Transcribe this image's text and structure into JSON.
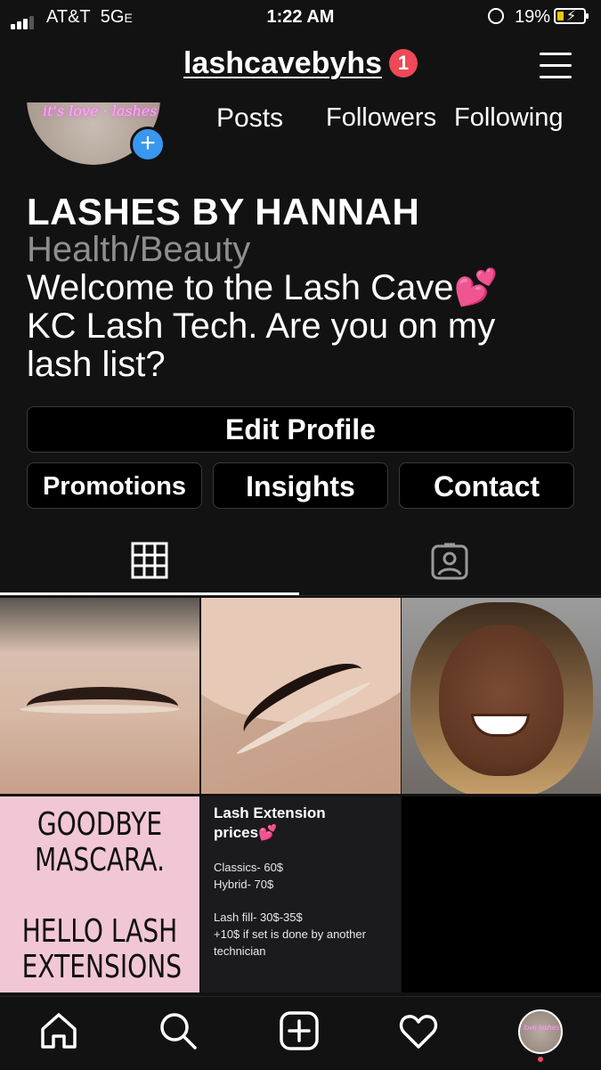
{
  "status_bar": {
    "carrier": "AT&T",
    "network": "5G",
    "network_suffix": "E",
    "time": "1:22 AM",
    "battery_percent": "19%",
    "battery_level": 0.19
  },
  "header": {
    "username": "lashcavebyhs",
    "notification_count": "1",
    "menu_icon": "hamburger-menu-icon"
  },
  "avatar": {
    "neon_text": "it's love · lashes",
    "add_icon": "+"
  },
  "stats": {
    "posts_label": "Posts",
    "followers_label": "Followers",
    "following_label": "Following"
  },
  "profile": {
    "display_name": "LASHES BY HANNAH",
    "category": "Health/Beauty",
    "bio_line1": "Welcome to the Lash Cave💕",
    "bio_line2": "KC Lash Tech. Are you on my",
    "bio_line3": "lash list?"
  },
  "buttons": {
    "edit_profile": "Edit Profile",
    "promotions": "Promotions",
    "insights": "Insights",
    "contact": "Contact"
  },
  "tabs": [
    {
      "icon": "grid-icon",
      "active": true
    },
    {
      "icon": "tagged-person-icon",
      "active": false
    }
  ],
  "posts": {
    "post4": {
      "line1": "GOODBYE",
      "line2": "MASCARA.",
      "line3": "HELLO LASH",
      "line4": "EXTENSIONS"
    },
    "post5": {
      "title1": "Lash Extension",
      "title2": "prices💕",
      "classics": "Classics- 60$",
      "hybrid": "Hybrid- 70$",
      "fill": "Lash fill- 30$-35$",
      "extra1": "+10$ if set is done by another",
      "extra2": "technician"
    }
  },
  "bottom_nav": [
    "home-icon",
    "search-icon",
    "new-post-icon",
    "activity-heart-icon",
    "profile-avatar"
  ],
  "colors": {
    "background": "#121212",
    "accent_blue": "#3897f0",
    "notification_red": "#ed4956",
    "category_gray": "#8e8e8e"
  }
}
